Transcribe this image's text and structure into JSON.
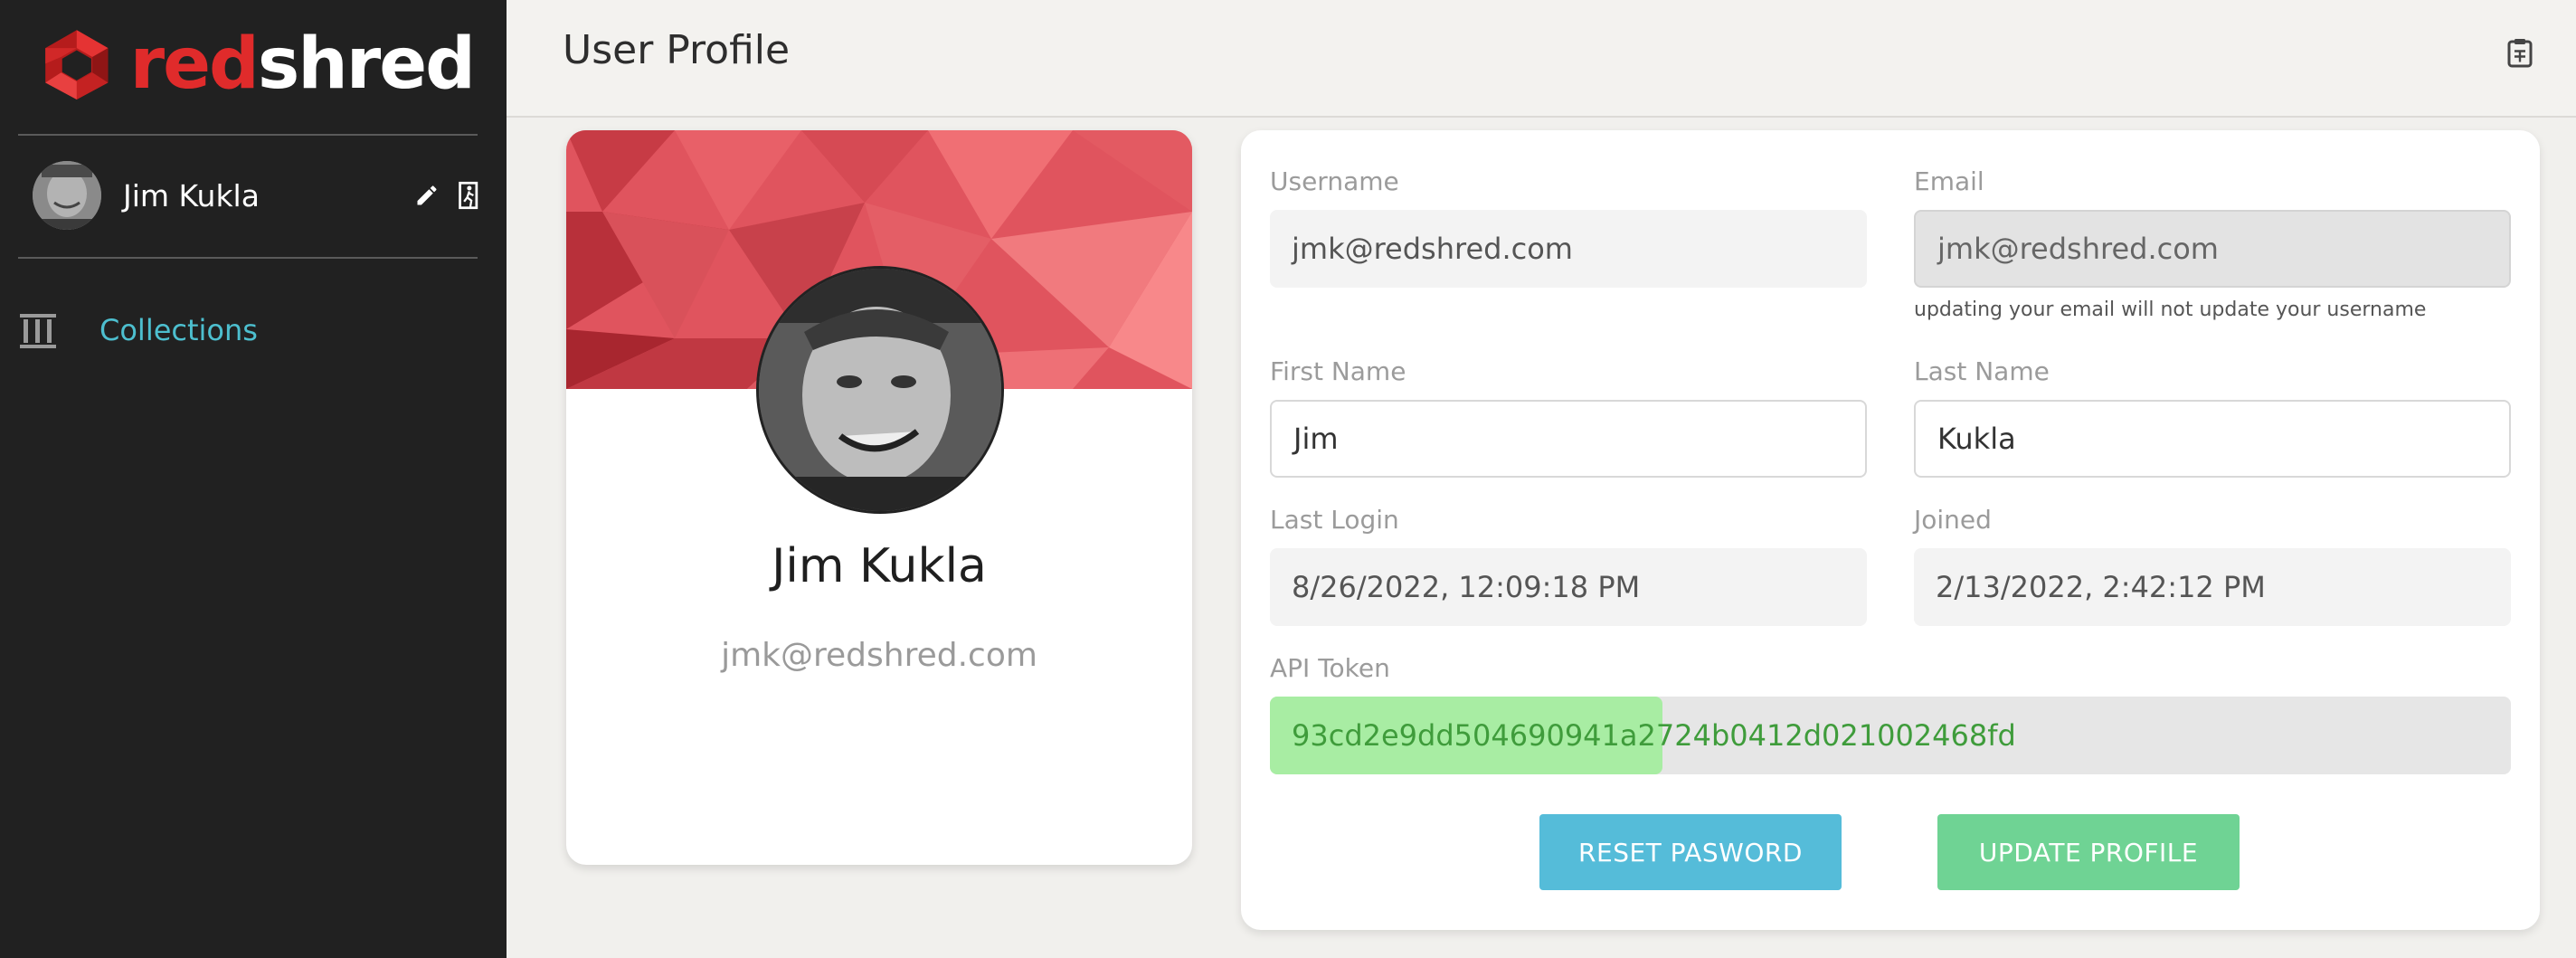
{
  "sidebar": {
    "logo": {
      "text_red": "red",
      "text_white": "shred"
    },
    "user": {
      "name": "Jim Kukla",
      "edit_icon": "pencil-icon",
      "logout_icon": "exit-icon"
    },
    "nav": [
      {
        "label": "Collections",
        "icon": "columns-icon"
      }
    ]
  },
  "header": {
    "title": "User Profile",
    "action_icon": "clipboard-icon"
  },
  "profile_card": {
    "name": "Jim Kukla",
    "email": "jmk@redshred.com"
  },
  "form": {
    "username": {
      "label": "Username",
      "value": "jmk@redshred.com"
    },
    "email": {
      "label": "Email",
      "value": "jmk@redshred.com",
      "hint": "updating your email will not update your username"
    },
    "first_name": {
      "label": "First Name",
      "value": "Jim"
    },
    "last_name": {
      "label": "Last Name",
      "value": "Kukla"
    },
    "last_login": {
      "label": "Last Login",
      "value": "8/26/2022, 12:09:18 PM"
    },
    "joined": {
      "label": "Joined",
      "value": "2/13/2022, 2:42:12 PM"
    },
    "api_token": {
      "label": "API Token",
      "value": "93cd2e9dd504690941a2724b0412d021002468fd",
      "fill_fraction": 0.316
    },
    "reset_button": "RESET PASWORD",
    "update_button": "UPDATE PROFILE"
  },
  "colors": {
    "sidebar_bg": "#212121",
    "accent_cyan": "#4dbfcf",
    "brand_red": "#e02b2b",
    "reset_button": "#55bcd9",
    "update_button": "#6fd394",
    "token_fill": "#a8eda3"
  }
}
